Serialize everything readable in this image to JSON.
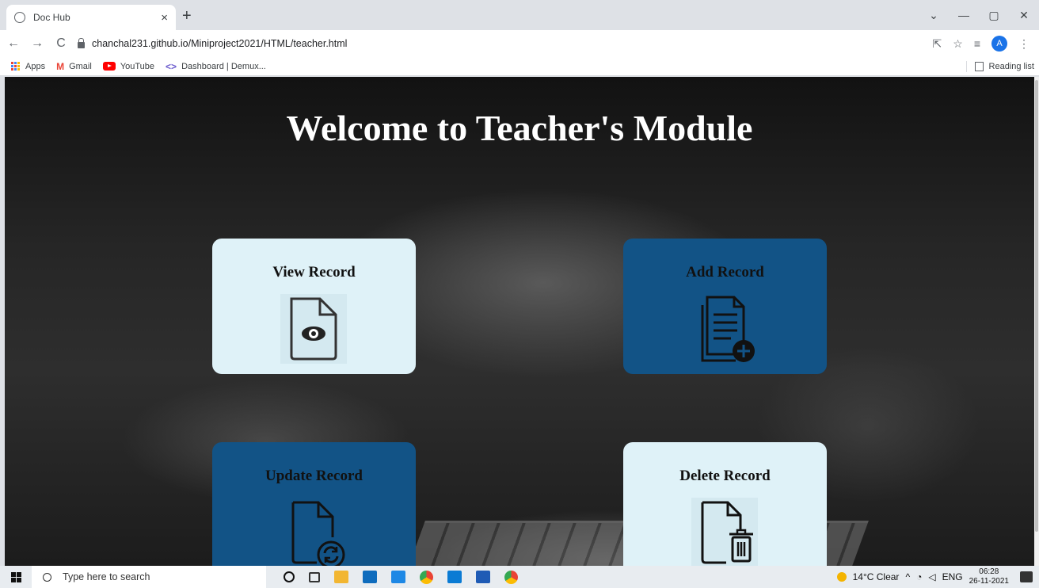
{
  "browser": {
    "tab_title": "Doc Hub",
    "tab_close": "×",
    "new_tab": "+",
    "window_controls": [
      "⌄",
      "—",
      "▢",
      "✕"
    ],
    "url": "chanchal231.github.io/Miniproject2021/HTML/teacher.html",
    "nav": {
      "back": "←",
      "forward": "→",
      "reload": "C"
    },
    "right_icons": {
      "share": "⇱",
      "star": "☆",
      "list": "≡",
      "avatar": "A",
      "menu": "⋮"
    },
    "bookmarks": [
      {
        "label": "Apps"
      },
      {
        "label": "Gmail"
      },
      {
        "label": "YouTube"
      },
      {
        "label": "Dashboard | Demux..."
      }
    ],
    "reading_list": "Reading list"
  },
  "page": {
    "heading": "Welcome to Teacher's Module",
    "cards": [
      {
        "label": "View Record",
        "icon": "view-file-icon",
        "theme": "light"
      },
      {
        "label": "Add Record",
        "icon": "add-file-icon",
        "theme": "dark"
      },
      {
        "label": "Update Record",
        "icon": "update-file-icon",
        "theme": "dark"
      },
      {
        "label": "Delete Record",
        "icon": "delete-file-icon",
        "theme": "light"
      }
    ],
    "colors": {
      "light_card": "#dff2f8",
      "dark_card": "#125386",
      "heading": "#ffffff"
    }
  },
  "taskbar": {
    "search_placeholder": "Type here to search",
    "weather": "14°C  Clear",
    "language": "ENG",
    "time": "06:28",
    "date": "26-11-2021"
  }
}
